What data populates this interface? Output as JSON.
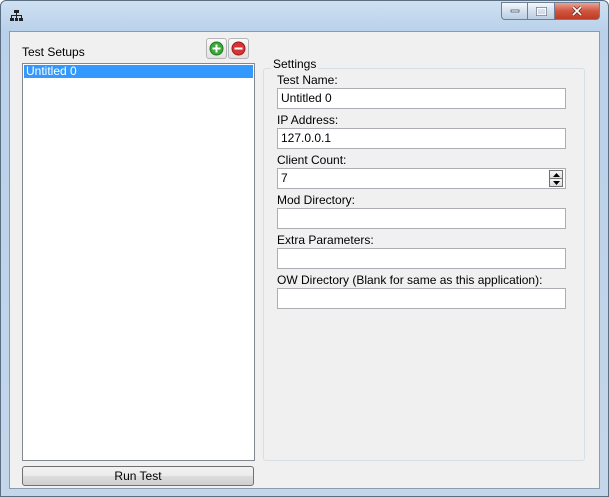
{
  "window": {
    "icon": "network-icon",
    "controls": {
      "minimize": "minimize-icon",
      "maximize": "maximize-icon",
      "close": "close-icon"
    }
  },
  "setups": {
    "label": "Test Setups",
    "items": [
      "Untitled 0"
    ],
    "selected_index": 0,
    "add_icon": "add-icon",
    "remove_icon": "remove-icon"
  },
  "settings": {
    "group_title": "Settings",
    "test_name": {
      "label": "Test Name:",
      "value": "Untitled 0"
    },
    "ip_address": {
      "label": "IP Address:",
      "value": "127.0.0.1"
    },
    "client_count": {
      "label": "Client Count:",
      "value": "7"
    },
    "mod_directory": {
      "label": "Mod Directory:",
      "value": ""
    },
    "extra_parameters": {
      "label": "Extra Parameters:",
      "value": ""
    },
    "ow_directory": {
      "label": "OW Directory (Blank for same as this application):",
      "value": ""
    }
  },
  "run_button": {
    "label": "Run Test"
  },
  "colors": {
    "selection": "#3399ff",
    "add": "#3aa93a",
    "remove": "#d93434",
    "close": "#c74a34"
  }
}
